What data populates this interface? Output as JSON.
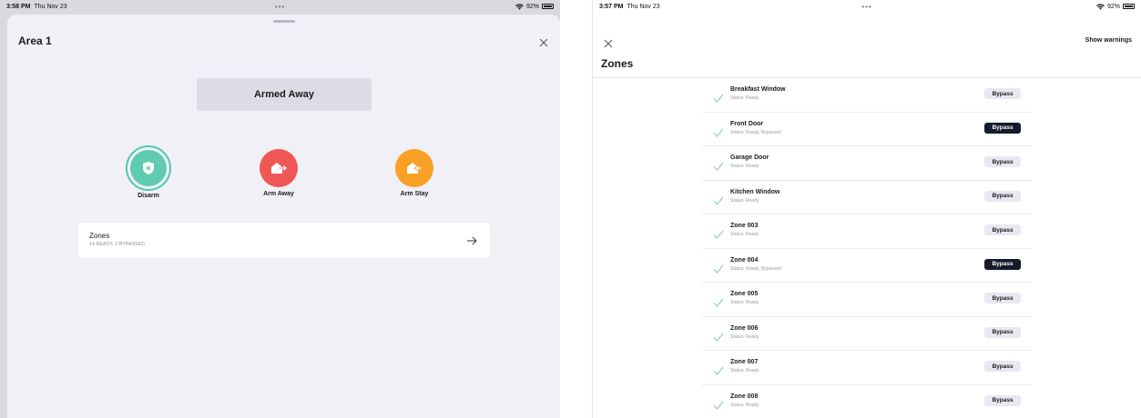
{
  "left": {
    "status": {
      "time": "3:58 PM",
      "day": "Thu Nov 23",
      "dots": "•••",
      "battery": "92%"
    },
    "area_title": "Area 1",
    "state": "Armed Away",
    "actions": [
      {
        "label": "Disarm",
        "icon": "shield-x-icon",
        "color": "#5ecbb2"
      },
      {
        "label": "Arm Away",
        "icon": "house-out-icon",
        "color": "#ef5757"
      },
      {
        "label": "Arm Stay",
        "icon": "house-in-icon",
        "color": "#f9a026"
      }
    ],
    "zones_card": {
      "title": "Zones",
      "subtitle": "14 READY, 2 BYPASSED"
    }
  },
  "right": {
    "status": {
      "time": "3:57 PM",
      "day": "Thu Nov 23",
      "dots": "•••",
      "battery": "92%"
    },
    "show_warnings": "Show warnings",
    "title": "Zones",
    "zones": [
      {
        "name": "Breakfast Window",
        "status": "Status: Ready",
        "bypass": "Bypass",
        "bypassed": false
      },
      {
        "name": "Front Door",
        "status": "Status: Ready, Bypassed",
        "bypass": "Bypass",
        "bypassed": true
      },
      {
        "name": "Garage Door",
        "status": "Status: Ready",
        "bypass": "Bypass",
        "bypassed": false
      },
      {
        "name": "Kitchen Window",
        "status": "Status: Ready",
        "bypass": "Bypass",
        "bypassed": false
      },
      {
        "name": "Zone 003",
        "status": "Status: Ready",
        "bypass": "Bypass",
        "bypassed": false
      },
      {
        "name": "Zone 004",
        "status": "Status: Ready, Bypassed",
        "bypass": "Bypass",
        "bypassed": true
      },
      {
        "name": "Zone 005",
        "status": "Status: Ready",
        "bypass": "Bypass",
        "bypassed": false
      },
      {
        "name": "Zone 006",
        "status": "Status: Ready",
        "bypass": "Bypass",
        "bypassed": false
      },
      {
        "name": "Zone 007",
        "status": "Status: Ready",
        "bypass": "Bypass",
        "bypassed": false
      },
      {
        "name": "Zone 008",
        "status": "Status: Ready",
        "bypass": "Bypass",
        "bypassed": false
      }
    ]
  }
}
